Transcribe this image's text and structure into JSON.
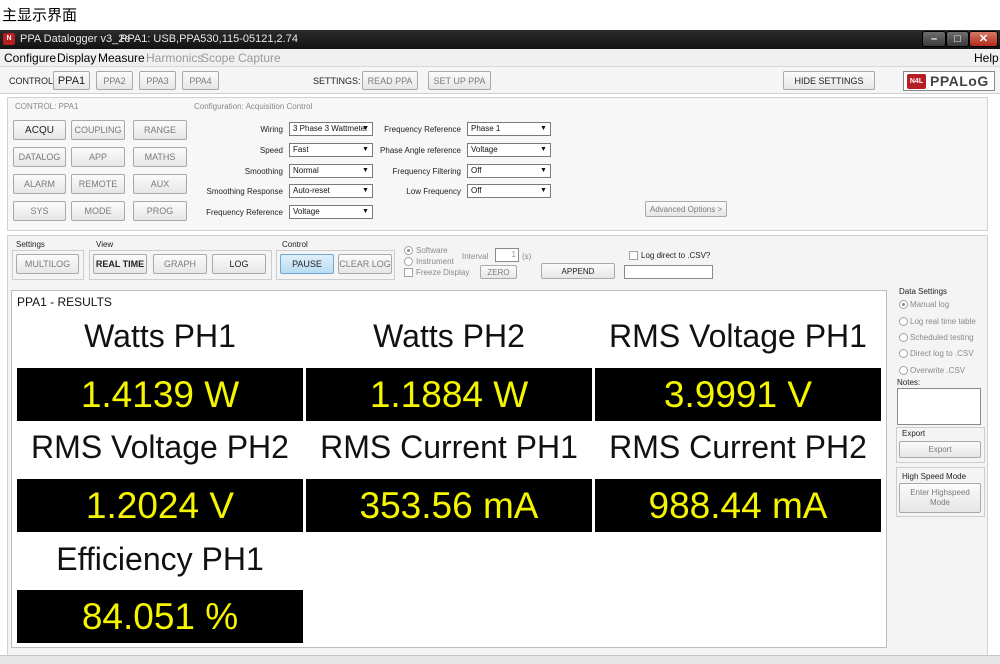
{
  "caption": "主显示界面",
  "window": {
    "title": "PPA Datalogger v3_2e",
    "subtitle": "PPA1: USB,PPA530,115-05121,2.74",
    "min_label": "–",
    "max_label": "□",
    "close_label": "✕"
  },
  "menu": {
    "items": [
      "Configure",
      "Display",
      "Measure",
      "Harmonics",
      "Scope",
      "Capture"
    ],
    "help": "Help"
  },
  "toolbar": {
    "control_label": "CONTROL:",
    "ppa_buttons": [
      "PPA1",
      "PPA2",
      "PPA3",
      "PPA4"
    ],
    "settings_label": "SETTINGS:",
    "read_ppa": "READ PPA",
    "set_up_ppa": "SET UP PPA",
    "hide_settings": "HIDE SETTINGS",
    "logo_mark": "N4L",
    "logo_text": "PPALoG"
  },
  "settings": {
    "control_caption": "CONTROL: PPA1",
    "config_caption": "Configuration: Acquisition Control",
    "nav_buttons": [
      [
        "ACQU",
        "COUPLING",
        "RANGE"
      ],
      [
        "DATALOG",
        "APP",
        "MATHS"
      ],
      [
        "ALARM",
        "REMOTE",
        "AUX"
      ],
      [
        "SYS",
        "MODE",
        "PROG"
      ]
    ],
    "left_fields": [
      {
        "label": "Wiring",
        "value": "3 Phase 3 Wattmeter"
      },
      {
        "label": "Speed",
        "value": "Fast"
      },
      {
        "label": "Smoothing",
        "value": "Normal"
      },
      {
        "label": "Smoothing Response",
        "value": "Auto-reset"
      },
      {
        "label": "Frequency Reference",
        "value": "Voltage"
      }
    ],
    "right_fields": [
      {
        "label": "Frequency Reference",
        "value": "Phase 1"
      },
      {
        "label": "Phase Angle reference",
        "value": "Voltage"
      },
      {
        "label": "Frequency Filtering",
        "value": "Off"
      },
      {
        "label": "Low Frequency",
        "value": "Off"
      }
    ],
    "advanced": "Advanced Options >"
  },
  "logbar": {
    "settings_group": "Settings",
    "multilog": "MULTILOG",
    "view_group": "View",
    "real_time": "REAL TIME",
    "graph": "GRAPH",
    "log": "LOG",
    "control_group": "Control",
    "pause": "PAUSE",
    "clear_log": "CLEAR LOG",
    "software": "Software",
    "instrument": "Instrument",
    "freeze": "Freeze Display",
    "interval_label": "Interval",
    "interval_value": "1",
    "interval_unit": "(s)",
    "zero": "ZERO",
    "append": "APPEND",
    "log_direct": "Log direct to .CSV?"
  },
  "results": {
    "title": "PPA1 - RESULTS",
    "items": [
      {
        "label": "Watts PH1",
        "value": "1.4139 W"
      },
      {
        "label": "Watts PH2",
        "value": "1.1884 W"
      },
      {
        "label": "RMS Voltage PH1",
        "value": "3.9991 V"
      },
      {
        "label": "RMS Voltage PH2",
        "value": "1.2024 V"
      },
      {
        "label": "RMS Current PH1",
        "value": "353.56 mA"
      },
      {
        "label": "RMS Current PH2",
        "value": "988.44 mA"
      },
      {
        "label": "Efficiency PH1",
        "value": "84.051 %"
      }
    ]
  },
  "side": {
    "data_settings": "Data Settings",
    "options": [
      "Manual log",
      "Log real time table",
      "Scheduled testing",
      "Direct log to .CSV",
      "Overwrite .CSV"
    ],
    "notes": "Notes:",
    "export_title": "Export",
    "export_button": "Export",
    "hs_title": "High Speed Mode",
    "hs_button": "Enter Highspeed Mode"
  }
}
